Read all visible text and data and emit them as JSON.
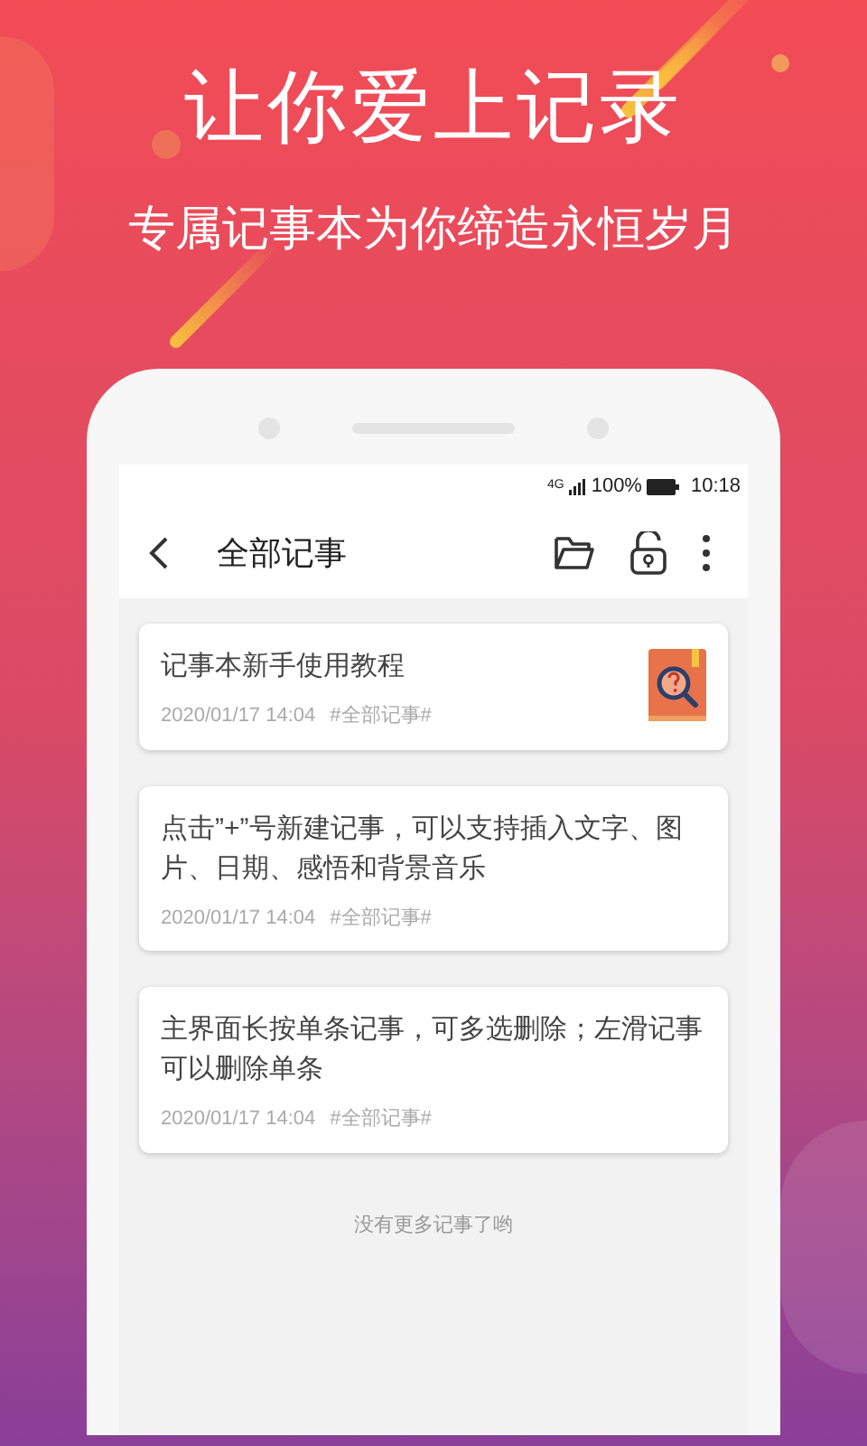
{
  "headline": "让你爱上记录",
  "subtitle": "专属记事本为你缔造永恒岁月",
  "status_bar": {
    "network": "4G",
    "battery": "100%",
    "time": "10:18"
  },
  "app_bar": {
    "title": "全部记事"
  },
  "notes": [
    {
      "kind": "thumbnail",
      "text": "记事本新手使用教程",
      "date": "2020/01/17 14:04",
      "tag": "#全部记事#"
    },
    {
      "kind": "plain",
      "text": "点击”+”号新建记事，可以支持插入文字、图片、日期、感悟和背景音乐",
      "date": "2020/01/17 14:04",
      "tag": "#全部记事#"
    },
    {
      "kind": "plain",
      "text": "主界面长按单条记事，可多选删除；左滑记事可以删除单条",
      "date": "2020/01/17 14:04",
      "tag": "#全部记事#"
    }
  ],
  "end_message": "没有更多记事了哟"
}
